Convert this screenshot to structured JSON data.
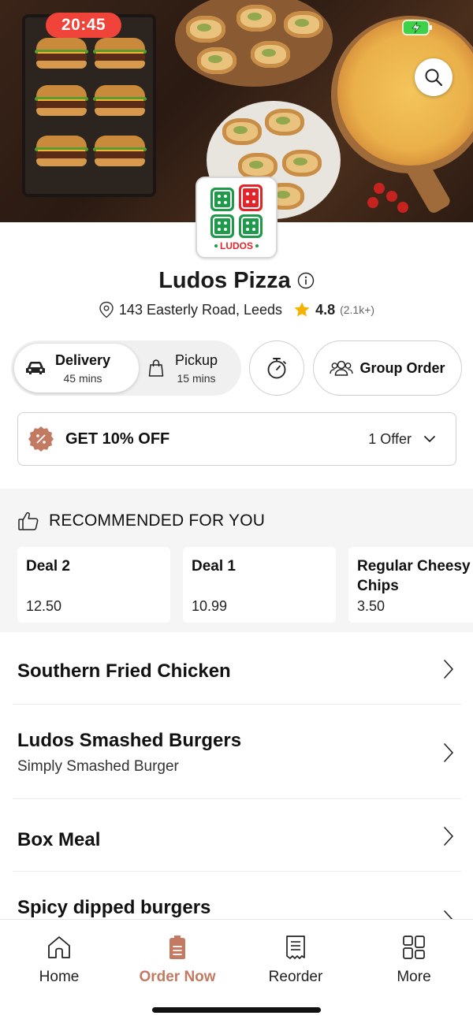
{
  "status_bar": {
    "time": "20:45"
  },
  "store": {
    "name": "Ludos Pizza",
    "logo_text": "LUDOS",
    "address": "143 Easterly Road, Leeds",
    "rating": "4.8",
    "rating_count": "(2.1k+)"
  },
  "modes": {
    "delivery": {
      "label": "Delivery",
      "time": "45 mins"
    },
    "pickup": {
      "label": "Pickup",
      "time": "15 mins"
    }
  },
  "group_order_label": "Group Order",
  "offer": {
    "title": "GET 10% OFF",
    "count": "1 Offer"
  },
  "recommended": {
    "heading": "RECOMMENDED FOR YOU",
    "items": [
      {
        "name": "Deal 2",
        "price": "12.50"
      },
      {
        "name": "Deal 1",
        "price": "10.99"
      },
      {
        "name": "Regular Cheesy Chips",
        "price": "3.50"
      }
    ]
  },
  "categories": [
    {
      "title": "Southern Fried Chicken",
      "subtitle": ""
    },
    {
      "title": "Ludos Smashed Burgers",
      "subtitle": "Simply Smashed Burger"
    },
    {
      "title": "Box Meal",
      "subtitle": ""
    },
    {
      "title": "Spicy dipped burgers",
      "subtitle": ""
    }
  ],
  "nav": {
    "home": "Home",
    "order_now": "Order Now",
    "reorder": "Reorder",
    "more": "More"
  },
  "colors": {
    "accent": "#c27a62",
    "status_pill": "#f0443a",
    "logo_green": "#1f9a4a",
    "logo_red": "#e0262b",
    "star": "#f5b301"
  }
}
